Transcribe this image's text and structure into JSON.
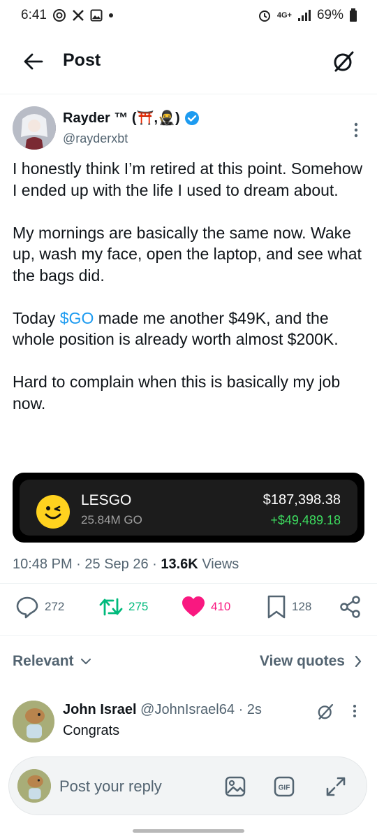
{
  "status_bar": {
    "time": "6:41",
    "left_icons": [
      "at-icon",
      "x-logo-icon",
      "gallery-icon",
      "dot-icon"
    ],
    "network": "4G+",
    "battery": "69%"
  },
  "header": {
    "title": "Post"
  },
  "tweet": {
    "author_name": "Rayder ™ (⛩️,🥷)",
    "author_handle": "@rayderxbt",
    "paragraphs": [
      "I honestly think I’m retired at this point. Somehow I ended up with the life I used to dream about.",
      "My mornings are basically the same now. Wake up, wash my face, open the laptop, and see what the bags did."
    ],
    "p3_before": "Today ",
    "p3_cashtag": "$GO",
    "p3_after": " made me another $49K, and the whole position is already worth almost $200K.",
    "p4": "Hard to complain when this is basically my job now.",
    "card": {
      "token_name": "LESGO",
      "token_amount": "25.84M GO",
      "value": "$187,398.38",
      "gain": "+$49,489.18"
    },
    "time": "10:48 PM",
    "date": "25 Sep 26",
    "views_count": "13.6K",
    "views_label": "Views",
    "replies": "272",
    "reposts": "275",
    "likes": "410",
    "bookmarks": "128"
  },
  "replies_section": {
    "sort_label": "Relevant",
    "view_quotes_label": "View quotes"
  },
  "reply": {
    "name": "John Israel",
    "handle": "@JohnIsrael64",
    "time": "· 2s",
    "text": "Congrats"
  },
  "reply_bar": {
    "placeholder": "Post your reply"
  },
  "colors": {
    "accent": "#1d9bf0",
    "repost": "#00ba7c",
    "like": "#f91880",
    "gain": "#3ddc5f"
  }
}
